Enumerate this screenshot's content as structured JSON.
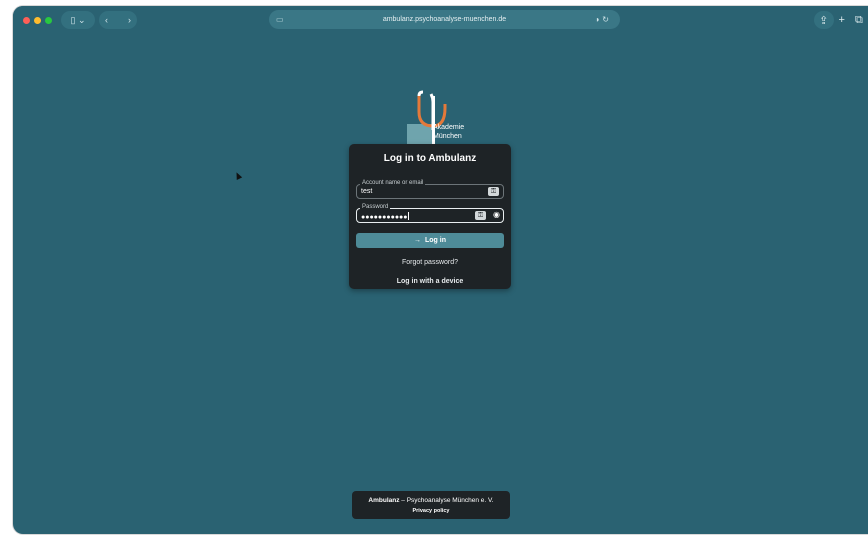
{
  "browser": {
    "url": "ambulanz.psychoanalyse-muenchen.de",
    "icons": {
      "sidebar": "sidebar-icon",
      "back": "chevron-left-icon",
      "forward": "chevron-right-icon",
      "share": "share-icon",
      "new_tab": "plus-icon",
      "tabs": "tab-overview-icon"
    }
  },
  "logo": {
    "line1": "Akademie",
    "line2": "München"
  },
  "login": {
    "title": "Log in to Ambulanz",
    "account": {
      "label": "Account name or email",
      "value": "test"
    },
    "password": {
      "label": "Password",
      "value": "●●●●●●●●●●●"
    },
    "submit_label": "Log in",
    "forgot_label": "Forgot password?",
    "device_label": "Log in with a device"
  },
  "footer": {
    "brand": "Ambulanz",
    "text": " – Psychoanalyse München e. V.",
    "privacy_label": "Privacy policy"
  },
  "colors": {
    "background": "#2a6272",
    "card": "#1e2326",
    "button": "#4e8b98",
    "logo_accent": "#e4793a"
  }
}
